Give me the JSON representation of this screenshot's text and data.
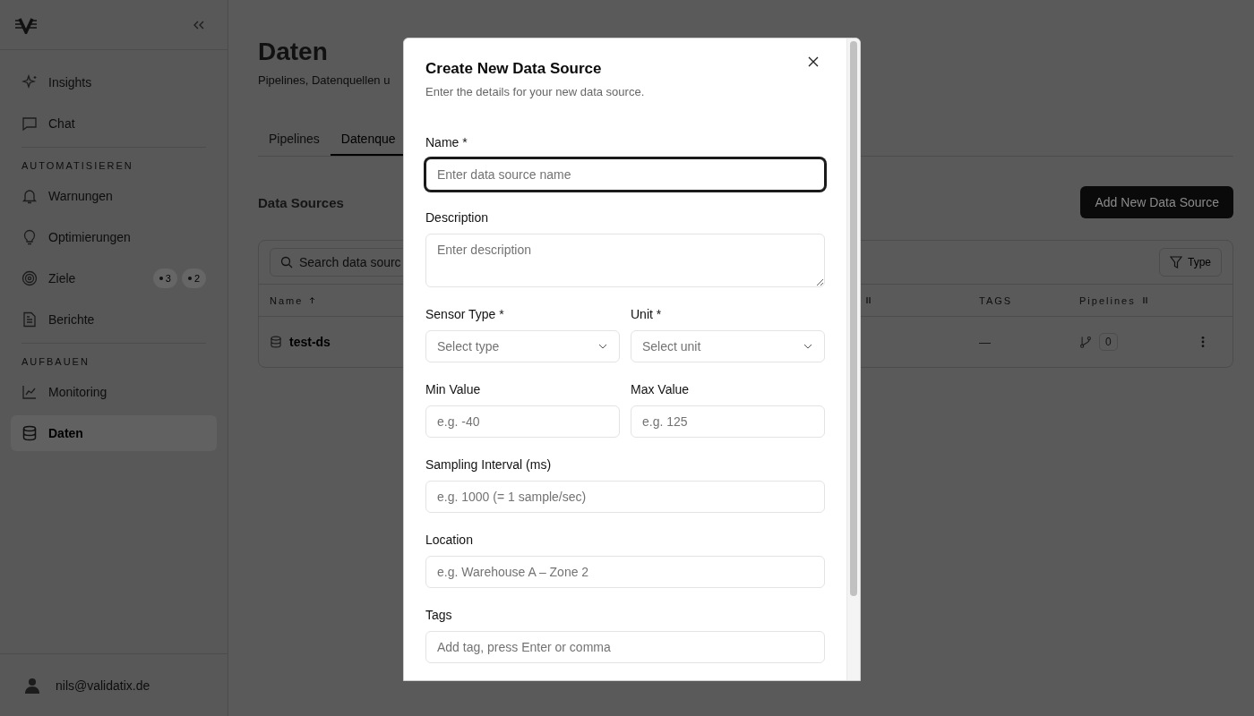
{
  "sidebar": {
    "sections": [
      {
        "items": [
          {
            "label": "Insights",
            "selected": false
          },
          {
            "label": "Chat",
            "selected": false
          }
        ]
      },
      {
        "heading": "AUTOMATISIEREN",
        "items": [
          {
            "label": "Warnungen",
            "selected": false
          },
          {
            "label": "Optimierungen",
            "selected": false
          },
          {
            "label": "Ziele",
            "selected": false,
            "badges": [
              "3",
              "2"
            ]
          },
          {
            "label": "Berichte",
            "selected": false
          }
        ]
      },
      {
        "heading": "AUFBAUEN",
        "items": [
          {
            "label": "Monitoring",
            "selected": false
          },
          {
            "label": "Daten",
            "selected": true
          }
        ]
      }
    ],
    "user": {
      "email": "nils@validatix.de"
    }
  },
  "main": {
    "title": "Daten",
    "subtitle": "Pipelines, Datenquellen u",
    "tabs": [
      {
        "label": "Pipelines",
        "selected": false
      },
      {
        "label": "Datenque",
        "selected": true
      }
    ],
    "section_title": "Data Sources",
    "add_button": "Add New Data Source",
    "table": {
      "search": {
        "placeholder": "Search data sourc"
      },
      "filter_button": "Type",
      "columns": [
        {
          "label": "Name",
          "sorted": true,
          "resizable": false
        },
        {
          "sorted": false,
          "resizable": true
        },
        {
          "label": "TAGS",
          "sorted": false,
          "resizable": false
        },
        {
          "label": "Pipelines",
          "sorted": false,
          "resizable": true
        }
      ],
      "rows": [
        {
          "name": "test-ds",
          "tags": "—",
          "pipelines": "0"
        }
      ]
    }
  },
  "dialog": {
    "title": "Create New Data Source",
    "description": "Enter the details for your new data source.",
    "rows": [
      [
        {
          "label": "Name *",
          "kind": "input",
          "placeholder": "Enter data source name",
          "focused": true
        }
      ],
      [
        {
          "label": "Description",
          "kind": "textarea",
          "placeholder": "Enter description",
          "focused": false
        }
      ],
      [
        {
          "label": "Sensor Type *",
          "kind": "select",
          "placeholder": "Select type",
          "focused": false
        },
        {
          "label": "Unit *",
          "kind": "select",
          "placeholder": "Select unit",
          "focused": false
        }
      ],
      [
        {
          "label": "Min Value",
          "kind": "input",
          "placeholder": "e.g. -40",
          "focused": false
        },
        {
          "label": "Max Value",
          "kind": "input",
          "placeholder": "e.g. 125",
          "focused": false
        }
      ],
      [
        {
          "label": "Sampling Interval (ms)",
          "kind": "input",
          "placeholder": "e.g. 1000 (= 1 sample/sec)",
          "focused": false
        }
      ],
      [
        {
          "label": "Location",
          "kind": "input",
          "placeholder": "e.g. Warehouse A – Zone 2",
          "focused": false
        }
      ],
      [
        {
          "label": "Tags",
          "kind": "input",
          "placeholder": "Add tag, press Enter or comma",
          "focused": false
        }
      ]
    ]
  }
}
